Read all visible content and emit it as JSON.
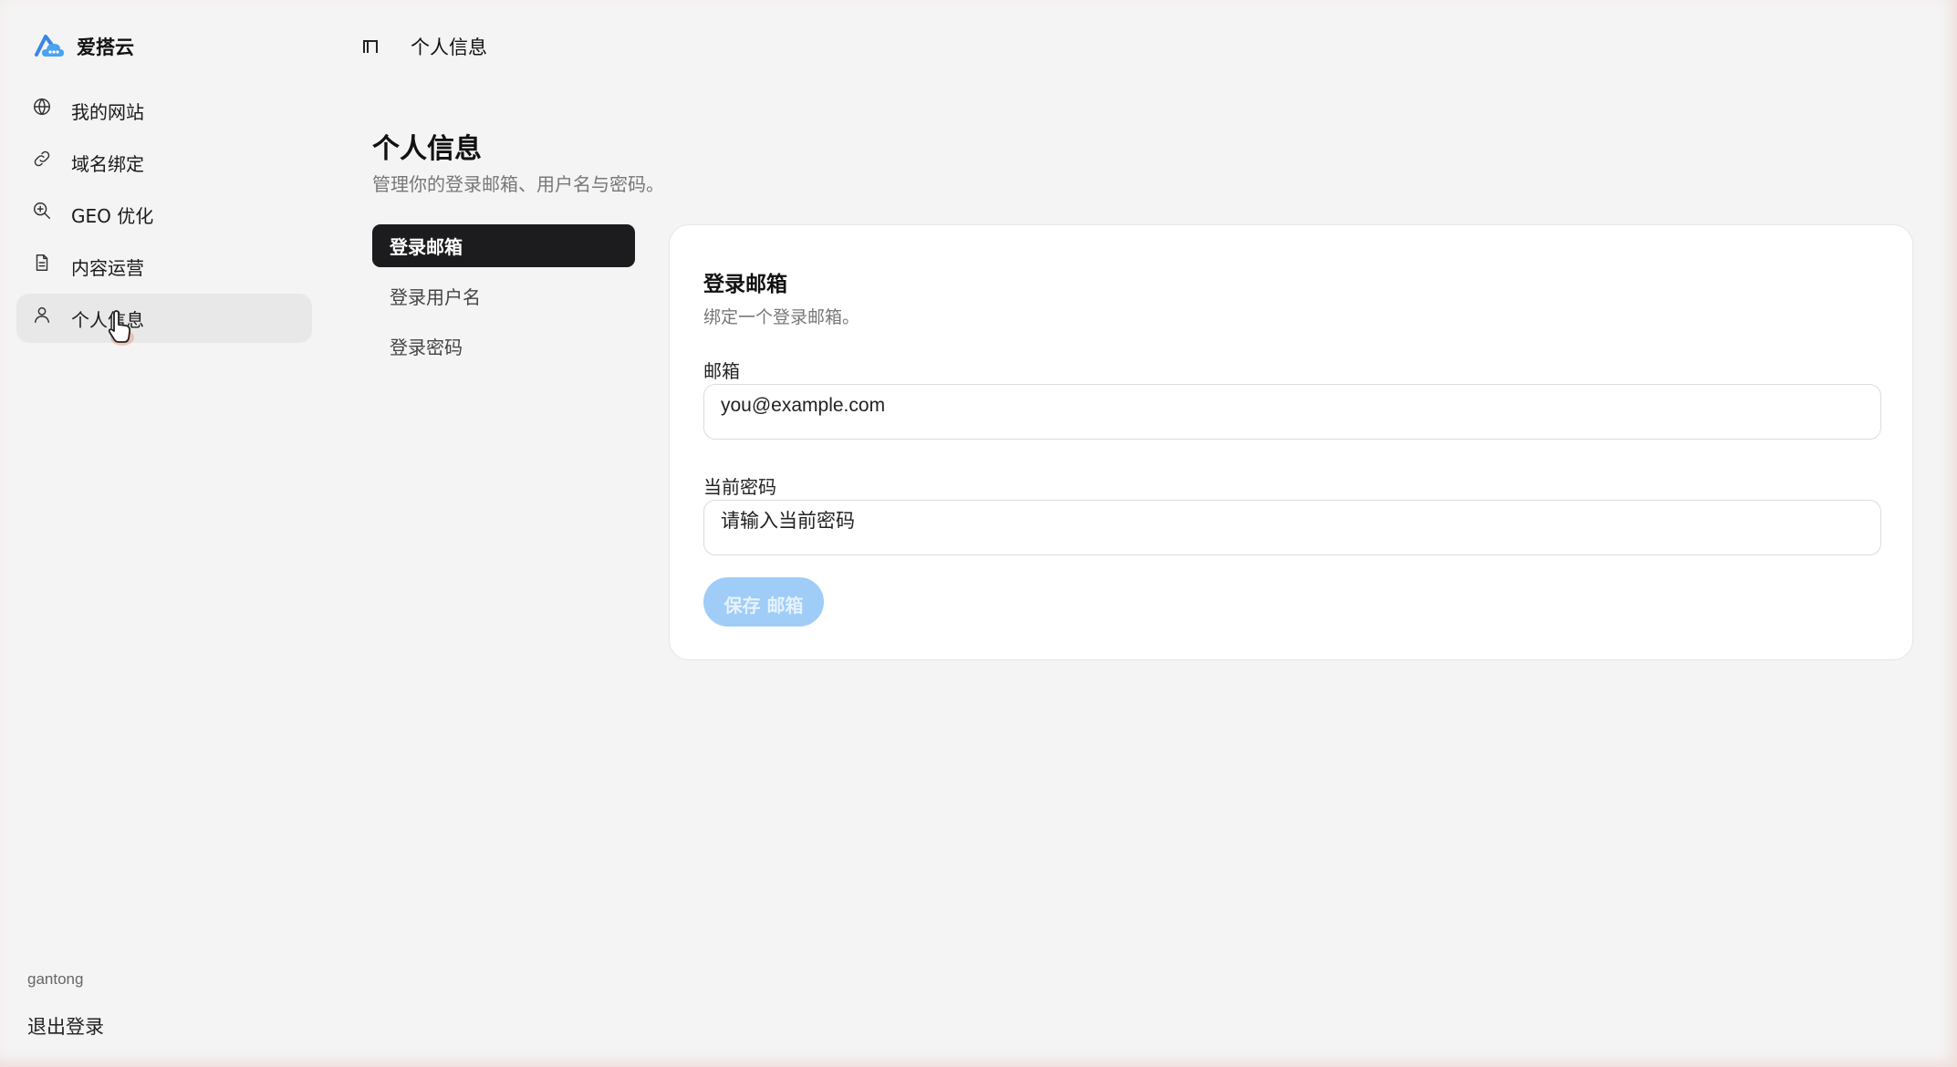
{
  "app": {
    "name": "爱搭云"
  },
  "sidebar": {
    "items": [
      {
        "label": "我的网站",
        "icon": "globe-icon"
      },
      {
        "label": "域名绑定",
        "icon": "link-icon"
      },
      {
        "label": "GEO 优化",
        "icon": "search-zoom-icon"
      },
      {
        "label": "内容运营",
        "icon": "document-icon"
      },
      {
        "label": "个人信息",
        "icon": "user-icon",
        "active": true
      }
    ],
    "username": "gantong",
    "logout_label": "退出登录"
  },
  "topbar": {
    "breadcrumb": "个人信息"
  },
  "page": {
    "title": "个人信息",
    "subtitle": "管理你的登录邮箱、用户名与密码。"
  },
  "tabs": [
    {
      "label": "登录邮箱",
      "active": true
    },
    {
      "label": "登录用户名"
    },
    {
      "label": "登录密码"
    }
  ],
  "card": {
    "title": "登录邮箱",
    "description": "绑定一个登录邮箱。",
    "email_label": "邮箱",
    "email_placeholder": "you@example.com",
    "password_label": "当前密码",
    "password_placeholder": "请输入当前密码",
    "save_label": "保存 邮箱"
  },
  "colors": {
    "accent": "#9fcdf7",
    "active_tab": "#1c1c1e",
    "background": "#f4f4f4"
  }
}
